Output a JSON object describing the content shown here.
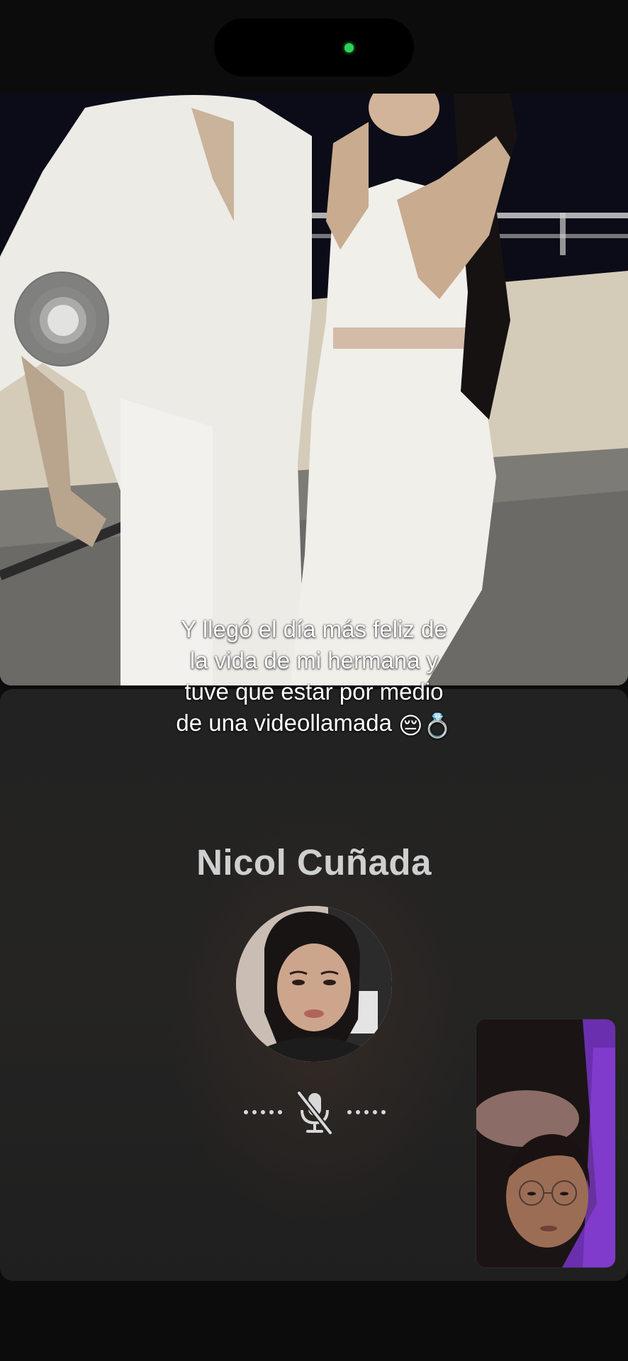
{
  "status": {
    "camera_indicator_color": "#30d158"
  },
  "caption": {
    "lines": [
      "Y llegó el día más feliz de",
      "la vida de mi hermana y",
      "tuve que estar por medio",
      "de una videollamada"
    ],
    "emojis": "😔💍"
  },
  "call": {
    "caller_name": "Nicol Cuñada",
    "microphone_state": "muted",
    "icon": "mic-off-icon"
  },
  "colors": {
    "call_panel_bg": "#232323",
    "caller_name_color": "#cfcfcf",
    "background": "#0c0c0c"
  }
}
